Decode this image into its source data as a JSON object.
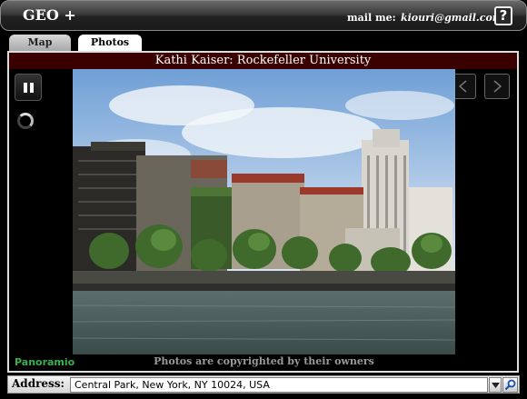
{
  "header": {
    "title": "GEO +",
    "mail_label": "mail me:",
    "mail_value": "kiouri@gmail.com",
    "help_label": "?"
  },
  "tabs": [
    {
      "label": "Map",
      "active": false
    },
    {
      "label": "Photos",
      "active": true
    }
  ],
  "photo": {
    "caption": "Kathi Kaiser: Rockefeller University",
    "copyright": "Photos are copyrighted by their owners",
    "provider": "Panoramio"
  },
  "controls": {
    "pause_icon": "pause-icon",
    "spinner_icon": "loading-spinner-icon",
    "prev_icon": "chevron-left-icon",
    "next_icon": "chevron-right-icon"
  },
  "address": {
    "label": "Address:",
    "value": "Central Park, New York, NY 10024, USA",
    "dropdown_icon": "chevron-down-icon",
    "search_icon": "search-icon"
  },
  "colors": {
    "caption_bar": "#3a0000",
    "panoramio_brand": "#3ab04a",
    "header_bg": "#222222"
  }
}
